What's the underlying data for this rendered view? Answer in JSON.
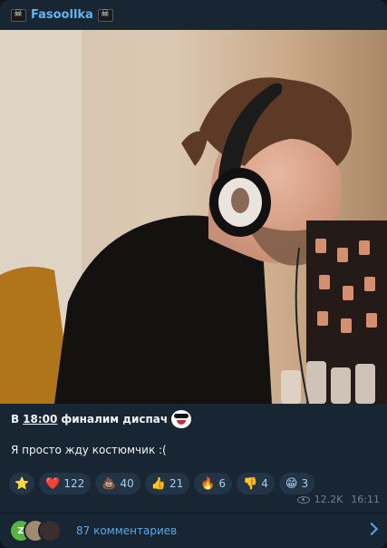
{
  "channel": {
    "name": "Fasoollka"
  },
  "photo": {
    "image_semantics": "man-wearing-headphones"
  },
  "post": {
    "line1_prefix": "В",
    "line1_time": "18:00",
    "line1_rest": "финалим диспач",
    "line2": "Я просто жду костюмчик :("
  },
  "reactions": [
    {
      "emoji": "⭐",
      "icon": "star-icon",
      "count": ""
    },
    {
      "emoji": "❤️",
      "icon": "heart-icon",
      "count": "122"
    },
    {
      "emoji": "💩",
      "icon": "poop-icon",
      "count": "40"
    },
    {
      "emoji": "👍",
      "icon": "thumbs-up-icon",
      "count": "21"
    },
    {
      "emoji": "🔥",
      "icon": "fire-icon",
      "count": "6"
    },
    {
      "emoji": "👎",
      "icon": "thumbs-down-icon",
      "count": "4"
    },
    {
      "emoji": "😁",
      "icon": "grin-icon",
      "count": "3"
    }
  ],
  "meta": {
    "views": "12.2K",
    "time": "16:11"
  },
  "comments": {
    "avatar_initial": "Z",
    "label": "87 комментариев"
  },
  "colors": {
    "background": "#182533",
    "accent": "#64b5ef",
    "reaction_bg": "#223446"
  }
}
